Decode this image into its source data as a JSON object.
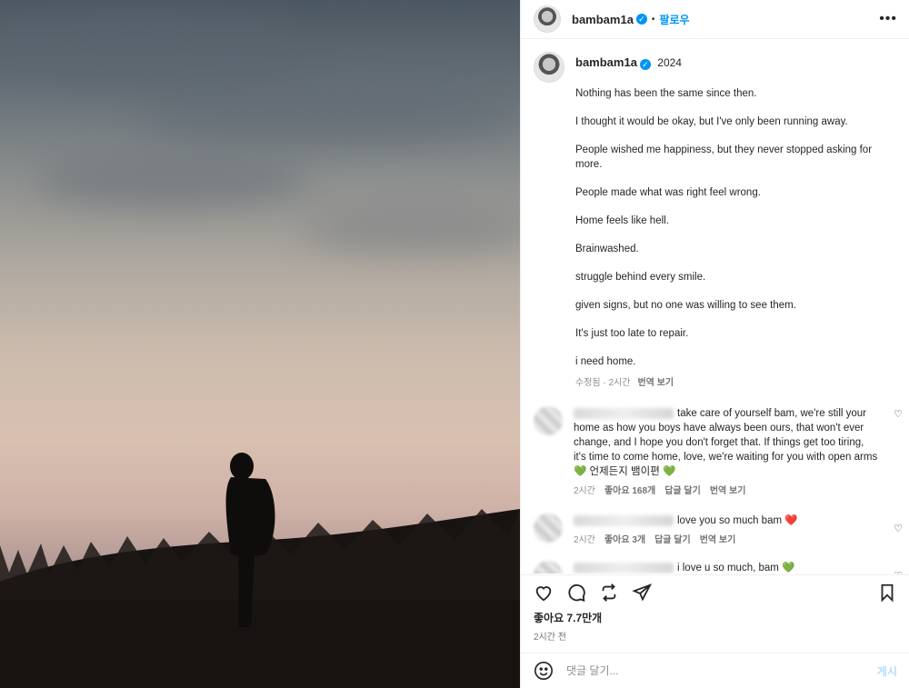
{
  "post": {
    "username": "bambam1a",
    "follow_label": "팔로우",
    "more_icon": "•••",
    "caption_year": "2024",
    "caption_lines": [
      "Nothing has been the same since then.",
      "I thought it would be okay, but I've only been running away.",
      "People wished me happiness, but they never stopped asking for more.",
      "People made what was right feel wrong.",
      "Home feels like hell.",
      "Brainwashed.",
      "struggle behind every smile.",
      "given signs, but no one was willing to see them.",
      "It's just too late to repair.",
      "i need home."
    ],
    "caption_meta": {
      "edited": "수정됨 · 2시간",
      "translate": "번역 보기"
    }
  },
  "comments": [
    {
      "text": "take care of yourself bam, we're still your home as how you boys have always been ours, that won't ever change, and I hope you don't forget that. If things get too tiring, it's time to come home, love, we're waiting for you with open arms💚 언제든지 뱀이편 💚",
      "time": "2시간",
      "likes": "좋아요 168개",
      "reply": "답글 달기",
      "translate": "번역 보기"
    },
    {
      "text": "love you so much bam ❤️",
      "time": "2시간",
      "likes": "좋아요 3개",
      "reply": "답글 달기",
      "translate": "번역 보기"
    },
    {
      "text": "i love u so much, bam 💚"
    }
  ],
  "footer": {
    "likes": "좋아요 7.7만개",
    "time": "2시간 전",
    "comment_placeholder": "댓글 달기...",
    "post_button": "게시"
  },
  "icons": [
    "heart-icon",
    "comment-icon",
    "share-icon",
    "send-icon",
    "bookmark-icon",
    "emoji-icon",
    "verified-icon"
  ],
  "colors": {
    "accent": "#0095f6",
    "text": "#262626",
    "muted": "#8e8e8e"
  }
}
